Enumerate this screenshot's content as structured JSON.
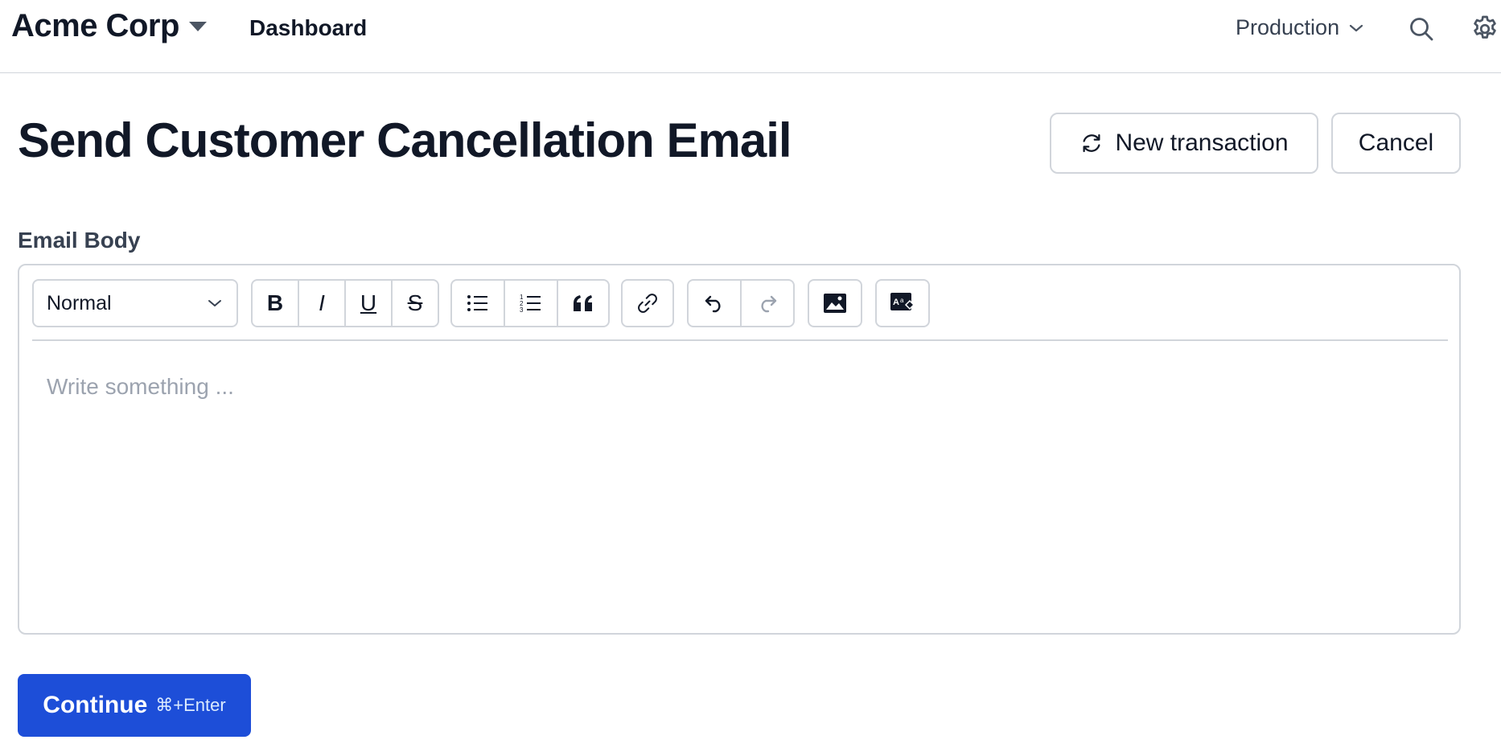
{
  "header": {
    "brand": "Acme Corp",
    "nav_link": "Dashboard",
    "environment": "Production",
    "icons": [
      "caret-down-icon",
      "chevron-down-icon",
      "search-icon",
      "gear-icon"
    ]
  },
  "page": {
    "title": "Send Customer Cancellation Email",
    "new_transaction_label": "New transaction",
    "cancel_label": "Cancel"
  },
  "form": {
    "field_label": "Email Body",
    "editor": {
      "format_value": "Normal",
      "placeholder": "Write something ...",
      "toolbar": {
        "bold": "B",
        "italic": "I",
        "underline": "U",
        "strike": "S",
        "icons": [
          "bullet-list-icon",
          "numbered-list-icon",
          "blockquote-icon",
          "link-icon",
          "undo-icon",
          "redo-icon",
          "image-icon",
          "variable-icon"
        ]
      }
    },
    "continue_label": "Continue",
    "continue_shortcut": "⌘+Enter"
  },
  "colors": {
    "primary": "#1d4ed8",
    "border": "#d1d5db",
    "text": "#111827",
    "placeholder": "#9ca3af"
  }
}
